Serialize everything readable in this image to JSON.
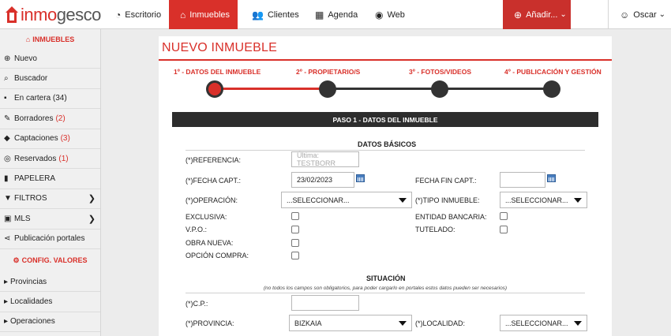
{
  "brand": {
    "part1": "inmo",
    "part2": "gesco"
  },
  "nav": {
    "escritorio": "Escritorio",
    "inmuebles": "Inmuebles",
    "clientes": "Clientes",
    "agenda": "Agenda",
    "web": "Web",
    "anadir": "Añadir...",
    "user": "Oscar"
  },
  "sidebar": {
    "header": "INMUEBLES",
    "items": [
      {
        "label": "Nuevo",
        "icon": "plus-circle-icon",
        "count": ""
      },
      {
        "label": "Buscador",
        "icon": "search-icon",
        "count": ""
      },
      {
        "label": "En cartera (34)",
        "icon": "briefcase-icon",
        "count": ""
      },
      {
        "label": "Borradores",
        "icon": "edit-icon",
        "count": "(2)"
      },
      {
        "label": "Captaciones",
        "icon": "tags-icon",
        "count": "(3)"
      },
      {
        "label": "Reservados",
        "icon": "eye-icon",
        "count": "(1)"
      },
      {
        "label": "PAPELERA",
        "icon": "trash-icon",
        "count": ""
      },
      {
        "label": "FILTROS",
        "icon": "filter-icon",
        "count": ""
      },
      {
        "label": "MLS",
        "icon": "mls-icon",
        "count": ""
      },
      {
        "label": "Publicación portales",
        "icon": "share-icon",
        "count": ""
      }
    ],
    "config_header": "CONFIG. VALORES",
    "config_items": [
      "Provincias",
      "Localidades",
      "Operaciones"
    ]
  },
  "page": {
    "title": "NUEVO INMUEBLE",
    "steps": [
      "1º - DATOS DEL INMUEBLE",
      "2º - PROPIETARIO/S",
      "3º - FOTOS/VIDEOS",
      "4º - PUBLICACIÓN Y GESTIÓN"
    ],
    "active_step": 1,
    "panel_title": "PASO 1 - DATOS DEL INMUEBLE",
    "basic": {
      "title": "DATOS BÁSICOS",
      "referencia_label": "(*)REFERENCIA:",
      "referencia_placeholder": "Última: TESTBORR",
      "fecha_capt_label": "(*)FECHA CAPT.:",
      "fecha_capt_value": "23/02/2023",
      "fecha_fin_label": "FECHA FIN CAPT.:",
      "operacion_label": "(*)OPERACIÓN:",
      "operacion_value": "...SELECCIONAR...",
      "tipo_label": "(*)TIPO INMUEBLE:",
      "tipo_value": "...SELECCIONAR...",
      "exclusiva_label": "EXCLUSIVA:",
      "entidad_label": "ENTIDAD BANCARIA:",
      "vpo_label": "V.P.O.:",
      "tutelado_label": "TUTELADO:",
      "obra_label": "OBRA NUEVA:",
      "opcion_label": "OPCIÓN COMPRA:"
    },
    "situacion": {
      "title": "SITUACIÓN",
      "note": "(no todos los campos son obligatorios, para poder cargarlo en portales estos datos pueden ser necesarios)",
      "cp_label": "(*)C.P.:",
      "provincia_label": "(*)PROVINCIA:",
      "provincia_value": "BIZKAIA",
      "localidad_label": "(*)LOCALIDAD:",
      "localidad_value": "...SELECCIONAR..."
    }
  },
  "colors": {
    "accent": "#d9302a",
    "dark": "#2d2d2d"
  }
}
